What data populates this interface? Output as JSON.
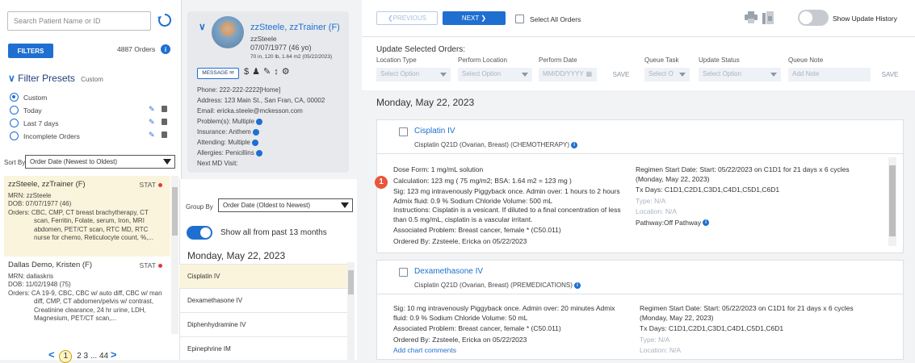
{
  "search": {
    "placeholder": "Search Patient Name or ID"
  },
  "filters": {
    "button": "FILTERS",
    "orders_count": "4887 Orders"
  },
  "filter_presets": {
    "title": "Filter Presets",
    "current": "Custom",
    "items": [
      {
        "label": "Custom",
        "selected": true
      },
      {
        "label": "Today",
        "selected": false
      },
      {
        "label": "Last 7 days",
        "selected": false
      },
      {
        "label": "Incomplete Orders",
        "selected": false
      }
    ]
  },
  "sort": {
    "label": "Sort By",
    "value": "Order Date (Newest to Oldest)"
  },
  "patients": [
    {
      "name": "zzSteele, zzTrainer (F)",
      "stat": "STAT",
      "mrn": "MRN: zzSteele",
      "dob": "DOB: 07/07/1977 (46)",
      "orders": "Orders: CBC, CMP, CT breast brachytherapy, CT scan, Ferritin, Folate, serum, Iron, MRI abdomen, PET/CT scan, RTC MD, RTC nurse for chemo, Reticulocyte count, %,..."
    },
    {
      "name": "Dallas Demo, Kristen (F)",
      "stat": "STAT",
      "mrn": "MRN: dallaskris",
      "dob": "DOB: 11/02/1948 (75)",
      "orders": "Orders: CA 19-9, CBC, CBC w/ auto diff, CBC w/ man diff, CMP, CT abdomen/pelvis w/ contrast, Creatinine clearance, 24 hr urine, LDH, Magnesium, PET/CT scan,..."
    }
  ],
  "pager": {
    "prev": "<",
    "current": "1",
    "pages": "2 3 ... 44",
    "next": ">"
  },
  "card": {
    "name": "zzSteele, zzTrainer (F)",
    "username": "zzSteele",
    "dob": "07/07/1977 (46 yo)",
    "vitals": "70 in, 120 lb, 1.64 m2 (05/22/2023)",
    "message": "MESSAGE",
    "phone": "Phone: 222-222-2222[Home]",
    "address": "Address: 123 Main St., San Fran, CA, 00002",
    "email": "Email: ericka.steele@mckesson.com",
    "problems": "Problem(s): Multiple",
    "insurance": "Insurance: Anthem",
    "attending": "Attending: Multiple",
    "allergies": "Allergies: Penicillins",
    "next_md": "Next MD Visit:"
  },
  "group": {
    "label": "Group By",
    "value": "Order Date (Oldest to Newest)"
  },
  "show_all": "Show all from past 13 months",
  "mid_date": "Monday, May 22, 2023",
  "mid_items": [
    "Cisplatin IV",
    "Dexamethasone IV",
    "Diphenhydramine IV",
    "Epinephrine IM"
  ],
  "toolbar": {
    "previous": "PREVIOUS",
    "next": "NEXT",
    "select_all": "Select All Orders",
    "show_history": "Show Update History"
  },
  "update": {
    "title": "Update Selected Orders:",
    "labels": [
      "Location Type",
      "Perform Location",
      "Perform Date",
      "Queue Task",
      "Update Status",
      "Queue Note"
    ],
    "select_placeholder": "Select Option",
    "queue_placeholder": "Select O",
    "date_placeholder": "MM/DD/YYYY",
    "note_placeholder": "Add Note",
    "save": "SAVE"
  },
  "right_date": "Monday, May 22, 2023",
  "orders": [
    {
      "title": "Cisplatin IV",
      "sub": "Cisplatin Q21D (Ovarian, Breast) (CHEMOTHERAPY)",
      "dose_form": "Dose Form: 1 mg/mL solution",
      "calculation": "Calculation: 123 mg ( 75 mg/m2; BSA: 1.64 m2 = 123 mg )",
      "sig": "Sig: 123 mg intravenously Piggyback once. Admin over: 1 hours to 2 hours Admix fluid: 0.9 % Sodium Chloride Volume: 500 mL",
      "instructions": "Instructions: Cisplatin is a vesicant. If diluted to a final concentration of less than 0.5 mg/mL, cisplatin is a vascular irritant.",
      "problem": "Associated Problem: Breast cancer, female * (C50.011)",
      "ordered": "Ordered By: Zzsteele, Ericka on 05/22/2023",
      "regimen": "Regimen Start Date: Start: 05/22/2023 on C1D1 for 21 days x 6 cycles (Monday, May 22, 2023)",
      "txdays": "Tx Days: C1D1,C2D1,C3D1,C4D1,C5D1,C6D1",
      "type": "Type: N/A",
      "location": "Location: N/A",
      "pathway": "Pathway:Off Pathway",
      "badge": "1"
    },
    {
      "title": "Dexamethasone IV",
      "sub": "Cisplatin Q21D (Ovarian, Breast) (PREMEDICATIONS)",
      "sig": "Sig: 10 mg intravenously Piggyback once. Admin over: 20 minutes Admix fluid: 0.9 % Sodium Chloride Volume: 50 mL",
      "problem": "Associated Problem: Breast cancer, female * (C50.011)",
      "ordered": "Ordered By: Zzsteele, Ericka on 05/22/2023",
      "add_comments": "Add chart comments",
      "regimen": "Regimen Start Date: Start: 05/22/2023 on C1D1 for 21 days x 6 cycles (Monday, May 22, 2023)",
      "txdays": "Tx Days: C1D1,C2D1,C3D1,C4D1,C5D1,C6D1",
      "type": "Type: N/A",
      "location": "Location: N/A"
    }
  ],
  "colors": {
    "accent": "#1f6fd1",
    "stat": "#e53935",
    "badge": "#e8553a",
    "selected_row": "#fbf4dc"
  }
}
